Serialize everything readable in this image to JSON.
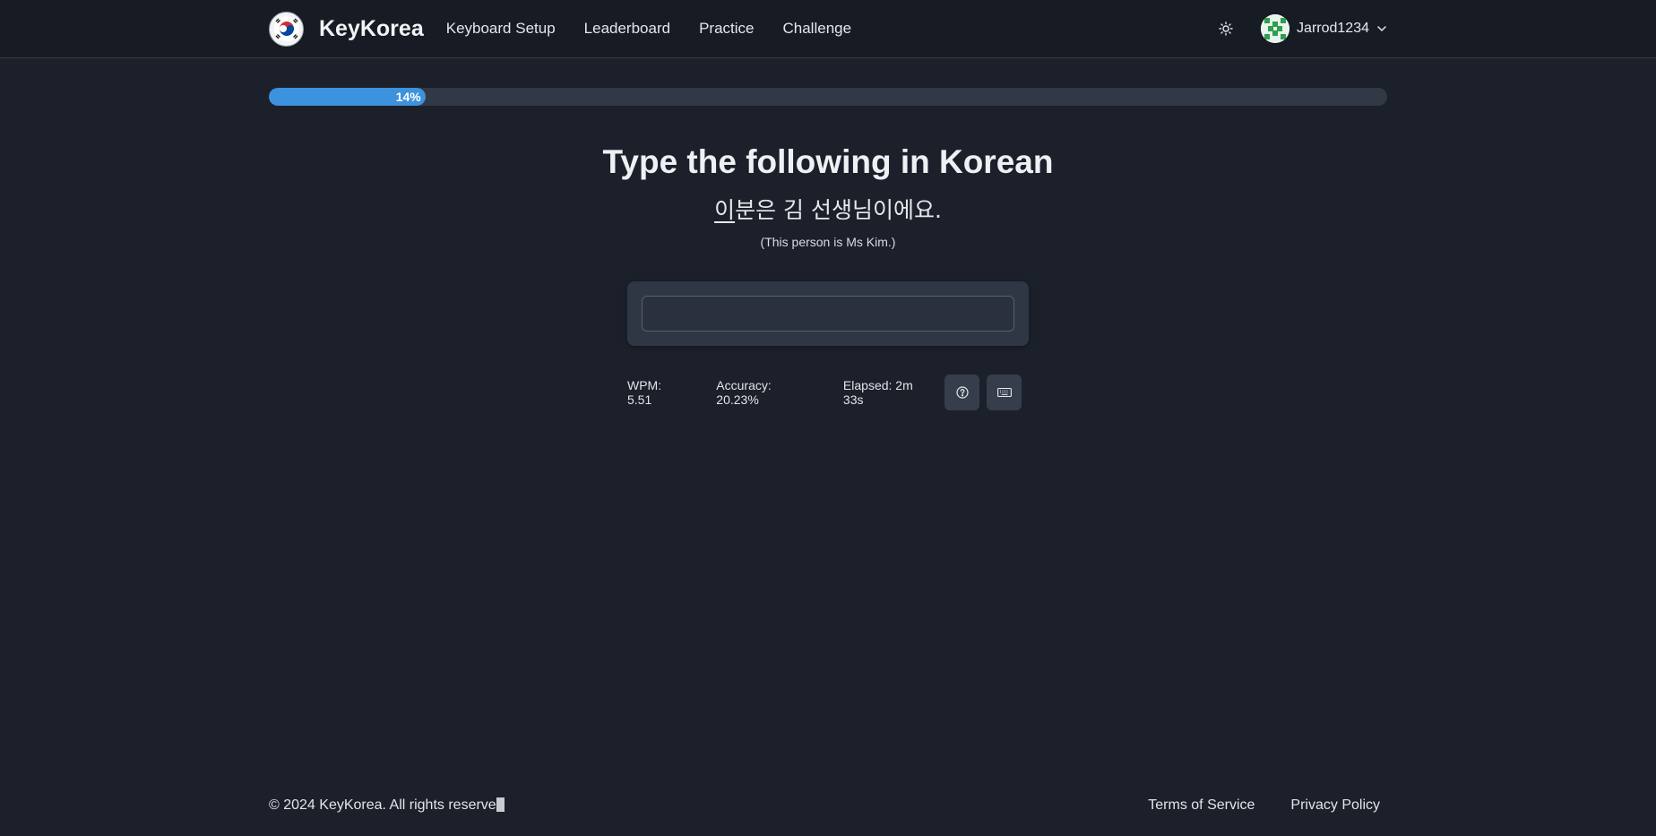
{
  "app": {
    "brand": "KeyKorea",
    "logo_icon": "korean-flag-icon"
  },
  "nav": {
    "links": [
      "Keyboard Setup",
      "Leaderboard",
      "Practice",
      "Challenge"
    ],
    "theme_icon": "sun-icon",
    "user": {
      "name": "Jarrod1234",
      "avatar_icon": "avatar-pattern-icon",
      "menu_icon": "chevron-down-icon"
    }
  },
  "progress": {
    "percent": 14,
    "label": "14%",
    "color": "#3d92dd"
  },
  "exercise": {
    "heading": "Type the following in Korean",
    "current_char": "이",
    "remaining_text": "분은 김 선생님이에요.",
    "translation": "(This person is Ms Kim.)",
    "input_value": ""
  },
  "stats": {
    "wpm": "WPM: 5.51",
    "accuracy": "Accuracy: 20.23%",
    "elapsed": "Elapsed: 2m 33s",
    "help_icon": "question-circle-icon",
    "keyboard_icon": "keyboard-icon"
  },
  "footer": {
    "copyright": "© 2024 KeyKorea. All rights reserve",
    "links": [
      "Terms of Service",
      "Privacy Policy"
    ]
  }
}
